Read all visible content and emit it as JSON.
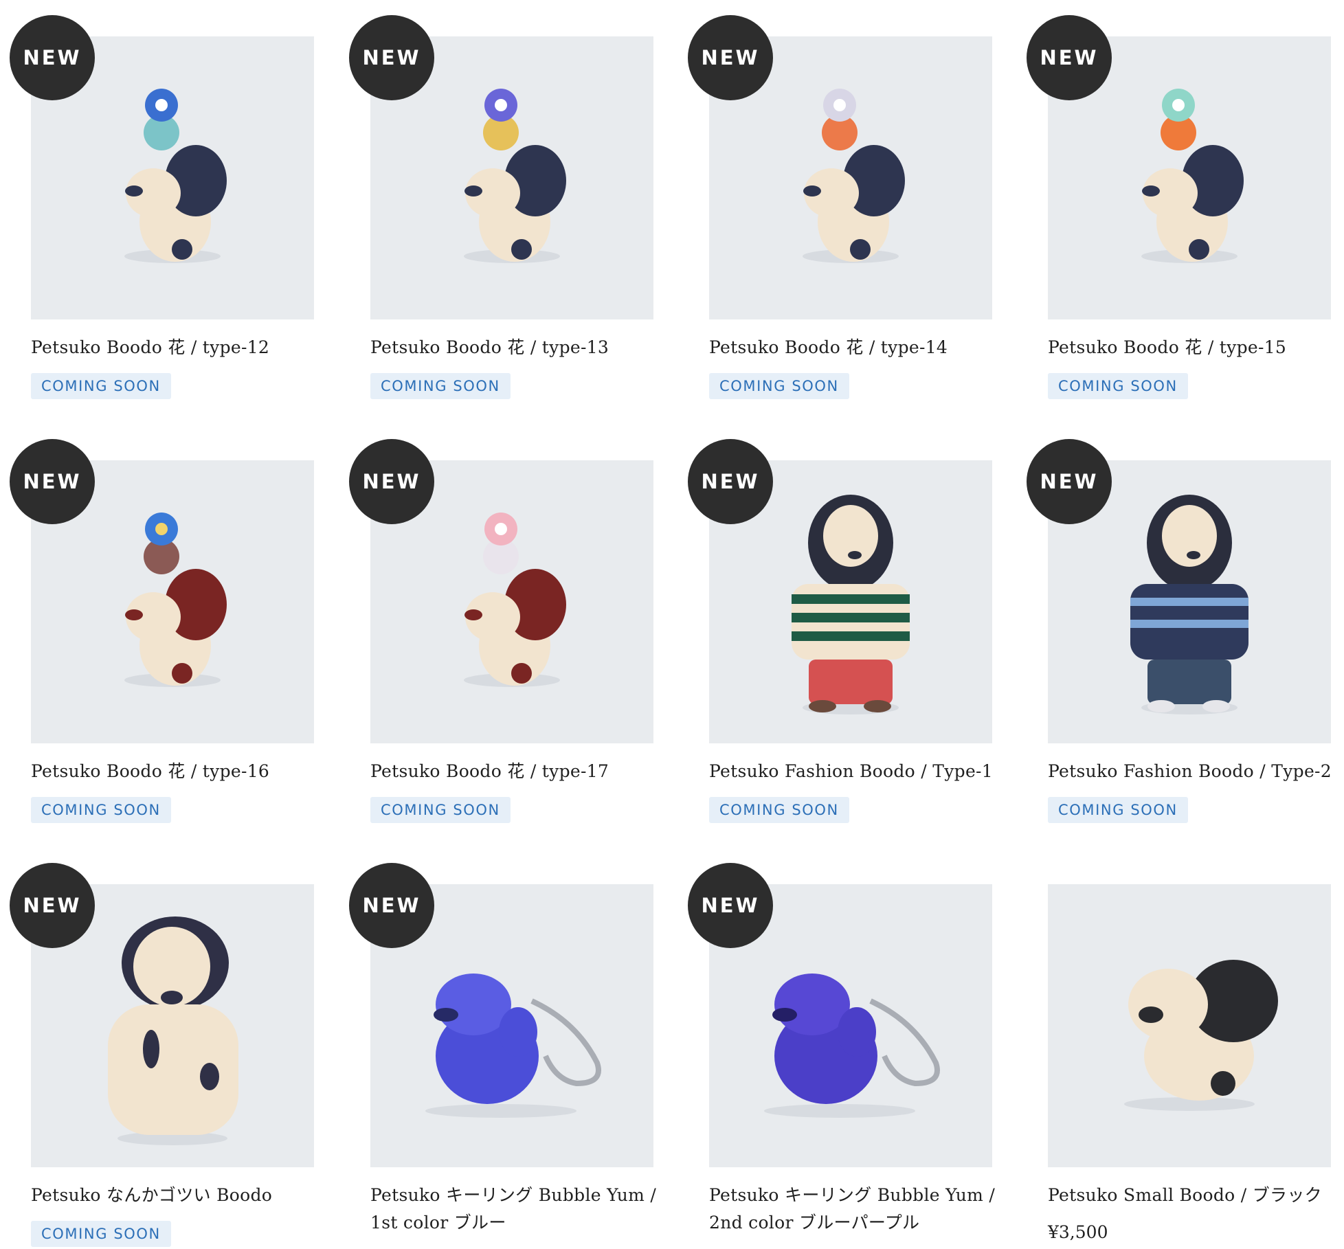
{
  "colors": {
    "tile_bg": "#e8ebee",
    "badge_bg": "#2d2d2d",
    "status_bg": "#e6eff8",
    "status_text": "#2c6fb7"
  },
  "products": [
    {
      "name": "Petsuko Boodo 花 / type-12",
      "badge": "NEW",
      "status": "COMING SOON",
      "price": ""
    },
    {
      "name": "Petsuko Boodo 花 / type-13",
      "badge": "NEW",
      "status": "COMING SOON",
      "price": ""
    },
    {
      "name": "Petsuko Boodo 花 / type-14",
      "badge": "NEW",
      "status": "COMING SOON",
      "price": ""
    },
    {
      "name": "Petsuko Boodo 花 / type-15",
      "badge": "NEW",
      "status": "COMING SOON",
      "price": ""
    },
    {
      "name": "Petsuko Boodo 花 / type-16",
      "badge": "NEW",
      "status": "COMING SOON",
      "price": ""
    },
    {
      "name": "Petsuko Boodo 花 / type-17",
      "badge": "NEW",
      "status": "COMING SOON",
      "price": ""
    },
    {
      "name": "Petsuko Fashion Boodo / Type-1",
      "badge": "NEW",
      "status": "COMING SOON",
      "price": ""
    },
    {
      "name": "Petsuko Fashion Boodo / Type-2",
      "badge": "NEW",
      "status": "COMING SOON",
      "price": ""
    },
    {
      "name": "Petsuko なんかゴツい Boodo",
      "badge": "NEW",
      "status": "COMING SOON",
      "price": ""
    },
    {
      "name": "Petsuko キーリング Bubble Yum / 1st color ブルー",
      "badge": "NEW",
      "status": "",
      "price": ""
    },
    {
      "name": "Petsuko キーリング Bubble Yum / 2nd color ブルーパープル",
      "badge": "NEW",
      "status": "",
      "price": ""
    },
    {
      "name": "Petsuko Small Boodo / ブラック",
      "badge": "",
      "status": "",
      "price": "¥3,500"
    }
  ]
}
